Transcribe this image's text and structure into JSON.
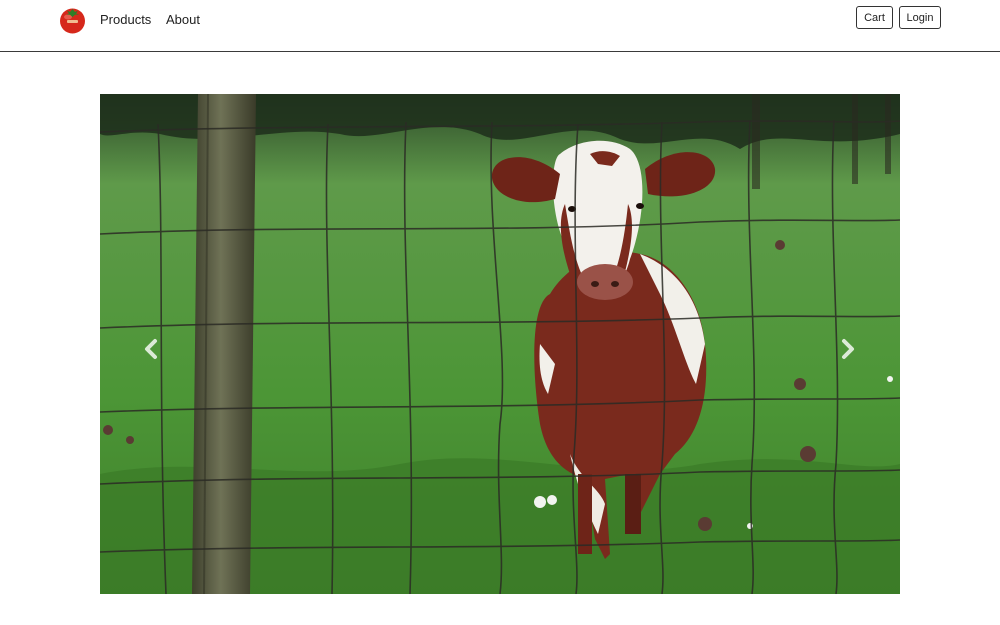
{
  "app": {
    "logo_icon": "tomato-logo-icon"
  },
  "nav": {
    "links": [
      {
        "label": "Products"
      },
      {
        "label": "About"
      }
    ],
    "cart_label": "Cart",
    "login_label": "Login"
  },
  "carousel": {
    "image_subject": "cow-behind-wire-fence",
    "prev_icon": "chevron-left-icon",
    "next_icon": "chevron-right-icon"
  },
  "colors": {
    "tomato_red": "#d6281b",
    "grass_green": "#4f9a3a",
    "cow_brown": "#7a2a1d",
    "border": "#333333"
  }
}
